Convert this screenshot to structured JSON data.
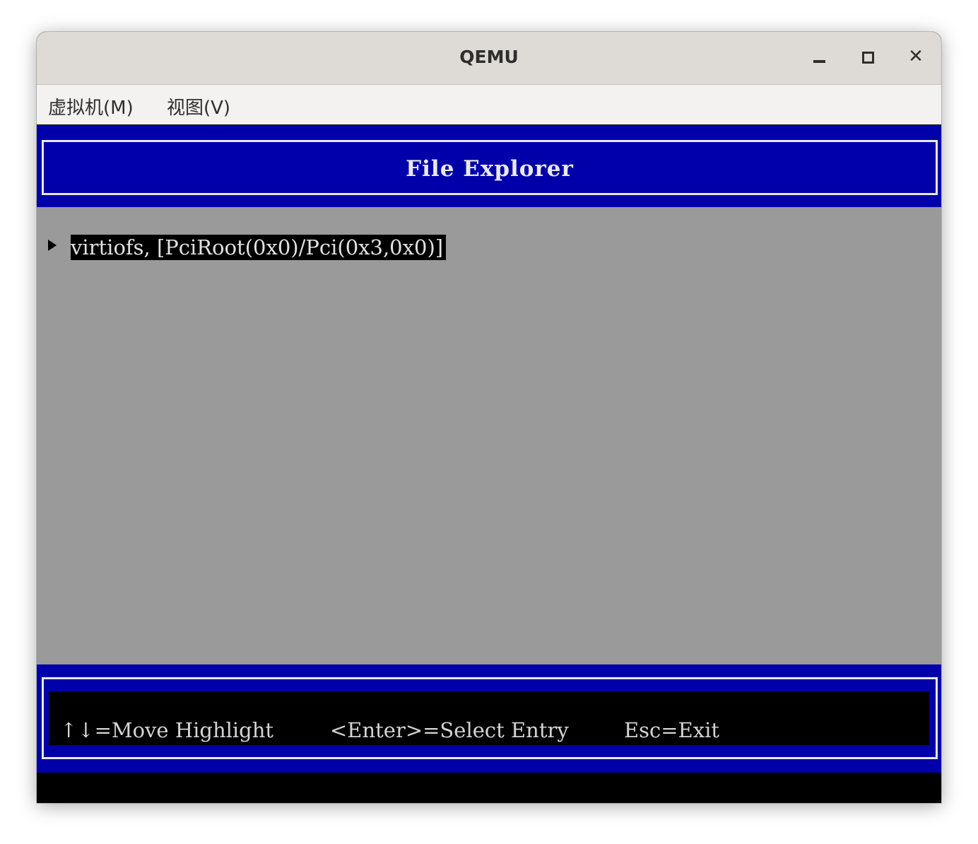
{
  "window": {
    "title": "QEMU",
    "controls": {
      "minimize_icon": "minimize-icon",
      "maximize_icon": "maximize-icon",
      "close_icon": "close-icon",
      "close_glyph": "✕"
    }
  },
  "menubar": {
    "items": [
      {
        "label": "虚拟机(M)"
      },
      {
        "label": "视图(V)"
      }
    ]
  },
  "screen": {
    "header_title": "File Explorer",
    "entries": [
      {
        "label": "virtiofs, [PciRoot(0x0)/Pci(0x3,0x0)]",
        "selected": true,
        "icon": "right-triangle-icon"
      }
    ],
    "help": {
      "move": "↑↓=Move Highlight",
      "select": "<Enter>=Select Entry",
      "exit": "Esc=Exit"
    },
    "colors": {
      "bar_blue": "#0000aa",
      "content_gray": "#9a9a9a",
      "highlight_black": "#000000",
      "text_light": "#e8e8e8"
    }
  }
}
